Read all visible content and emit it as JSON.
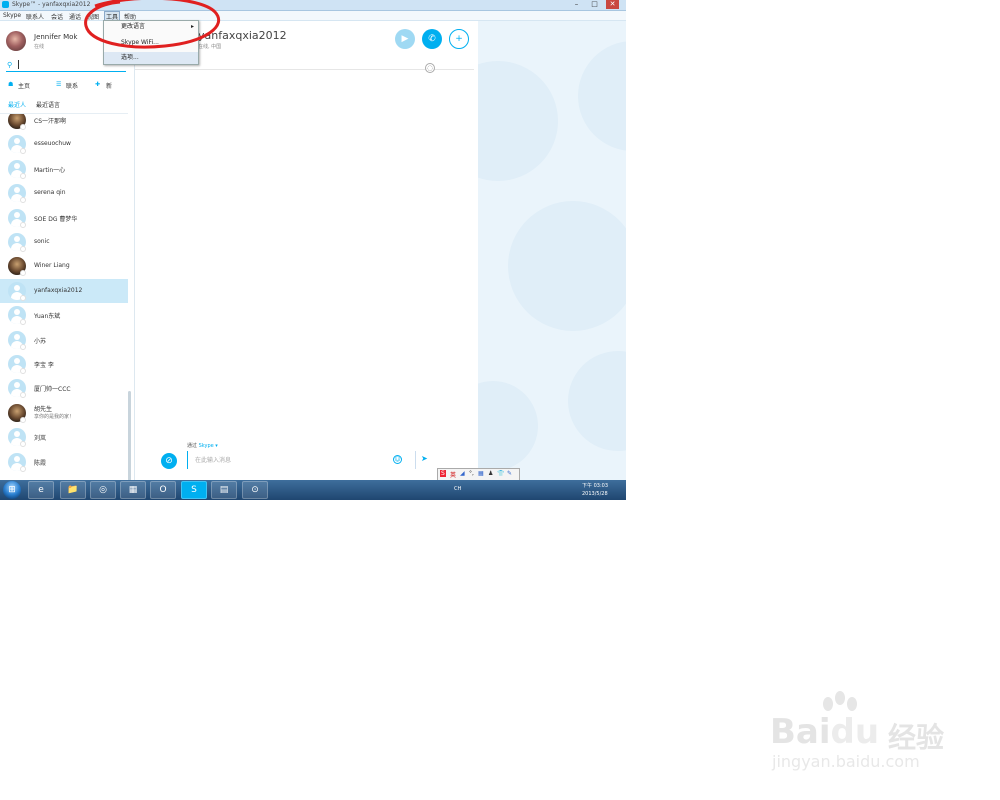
{
  "window": {
    "title": "Skype™ - yanfaxqxia2012",
    "min_glyph": "–",
    "max_glyph": "□",
    "close_glyph": "✕"
  },
  "menubar": {
    "items": [
      "Skype",
      "联系人",
      "会话",
      "通话",
      "视图",
      "工具",
      "帮助"
    ],
    "active_index": 5
  },
  "dropdown": {
    "items": [
      "更改语言",
      "Skype WiFi...",
      "选项..."
    ],
    "submenu_arrow": "▸"
  },
  "profile": {
    "name": "Jennifer Mok",
    "status": "在线"
  },
  "search": {
    "value": ""
  },
  "nav": {
    "home_icon": "☗",
    "home_label": "主页",
    "contacts_icon": "☰",
    "contacts_label": "联系",
    "add_icon": "✚",
    "add_label": "新"
  },
  "filters": {
    "first": "最近人",
    "second": "最近语言"
  },
  "contacts": [
    {
      "name": "CS一汗那啊",
      "mood": "",
      "photo": true,
      "online": false
    },
    {
      "name": "esseuochuw",
      "mood": "",
      "photo": false,
      "online": false
    },
    {
      "name": "Martin一心",
      "mood": "",
      "photo": false,
      "online": false
    },
    {
      "name": "serena qin",
      "mood": "",
      "photo": false,
      "online": false
    },
    {
      "name": "SOE DG 曹梦华",
      "mood": "",
      "photo": false,
      "online": false
    },
    {
      "name": "sonic",
      "mood": "",
      "photo": false,
      "online": false
    },
    {
      "name": "Winer Liang",
      "mood": "",
      "photo": true,
      "online": false
    },
    {
      "name": "yanfaxqxia2012",
      "mood": "",
      "photo": false,
      "online": false,
      "selected": true
    },
    {
      "name": "Yuan东斌",
      "mood": "",
      "photo": false,
      "online": false
    },
    {
      "name": "小苏",
      "mood": "",
      "photo": false,
      "online": false
    },
    {
      "name": "李宝 李",
      "mood": "",
      "photo": false,
      "online": false
    },
    {
      "name": "厦门帅一CCC",
      "mood": "",
      "photo": false,
      "online": false
    },
    {
      "name": "胡先生",
      "mood": "享你的是我的家！",
      "photo": true,
      "online": false
    },
    {
      "name": "刘岚",
      "mood": "",
      "photo": false,
      "online": false
    },
    {
      "name": "陈霞",
      "mood": "",
      "photo": false,
      "online": false
    }
  ],
  "conversation": {
    "title": "yanfaxqxia2012",
    "subtitle": "在线, 中国",
    "video_icon": "▶",
    "call_icon": "✆",
    "add_people_icon": "+",
    "globe_icon": "◌",
    "via_label": "通过",
    "via_service": "Skype ▾",
    "attach_icon": "⊘",
    "input_placeholder": "在此输入消息",
    "emoji_icon": "☺",
    "send_icon": "➤"
  },
  "ime": {
    "items": [
      "S",
      "英",
      "◢",
      "°,",
      "▦",
      "♟",
      "👕",
      "✎"
    ]
  },
  "taskbar": {
    "start_icon": "⊞",
    "apps": [
      "e",
      "📁",
      "◎",
      "▦",
      "O",
      "S",
      "▤",
      "⊙"
    ],
    "tray_text": "CH",
    "time": "下午 03:03",
    "date": "2013/5/28"
  },
  "watermark": {
    "brand_latin": "Bai",
    "brand_du": "du",
    "brand_cn": "经验",
    "url": "jingyan.baidu.com"
  }
}
